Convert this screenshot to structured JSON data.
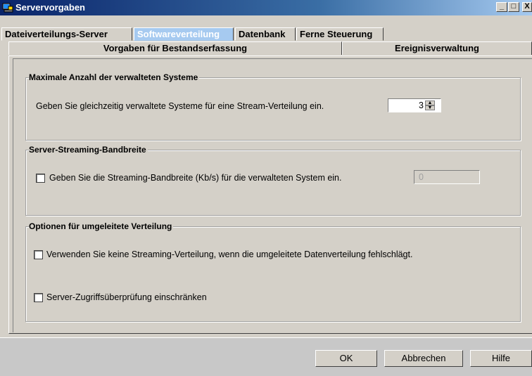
{
  "window": {
    "title": "Servervorgaben"
  },
  "title_buttons": {
    "minimize": "_",
    "maximize": "□",
    "close": "X"
  },
  "tabs_row1": [
    {
      "label": "Dateiverteilungs-Server",
      "active": false
    },
    {
      "label": "Softwareverteilung",
      "active": true
    },
    {
      "label": "Datenbank",
      "active": false
    },
    {
      "label": "Ferne Steuerung",
      "active": false
    }
  ],
  "tabs_row2": [
    {
      "label": "Vorgaben für Bestandserfassung"
    },
    {
      "label": "Ereignisverwaltung"
    }
  ],
  "groups": {
    "max_systems": {
      "title": "Maximale Anzahl der verwalteten Systeme",
      "label": "Geben Sie gleichzeitig verwaltete Systeme für eine Stream-Verteilung ein.",
      "value": "3"
    },
    "bandwidth": {
      "title": "Server-Streaming-Bandbreite",
      "label": "Geben Sie die Streaming-Bandbreite (Kb/s) für die verwalteten System ein.",
      "value": "0",
      "checked": false
    },
    "redirect": {
      "title": "Optionen für umgeleitete Verteilung",
      "option1": "Verwenden Sie keine Streaming-Verteilung, wenn die umgeleitete Datenverteilung fehlschlägt.",
      "option1_checked": false,
      "option2": "Server-Zugriffsüberprüfung einschränken",
      "option2_checked": false
    }
  },
  "buttons": {
    "ok": "OK",
    "cancel": "Abbrechen",
    "help": "Hilfe"
  }
}
